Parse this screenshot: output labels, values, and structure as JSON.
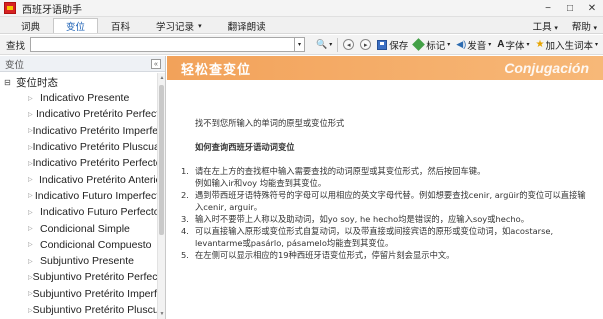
{
  "window": {
    "title": "西班牙语助手",
    "controls": {
      "minimize": "−",
      "maximize": "□",
      "close": "✕"
    }
  },
  "menu": {
    "tabs": [
      {
        "label": "词典",
        "active": false
      },
      {
        "label": "变位",
        "active": true
      },
      {
        "label": "百科",
        "active": false
      },
      {
        "label": "学习记录",
        "active": false,
        "dropdown": true
      },
      {
        "label": "翻译朗读",
        "active": false
      }
    ],
    "right": [
      {
        "label": "工具",
        "dropdown": true
      },
      {
        "label": "帮助",
        "dropdown": true
      }
    ],
    "dropdown_arrow": "▾"
  },
  "toolbar": {
    "search_label": "查找",
    "search_value": "",
    "search_dropdown": "▾",
    "search_icon": "magnifier-icon",
    "back": "◂",
    "forward": "▸",
    "save_label": "保存",
    "tag_label": "标记",
    "pronounce_label": "发音",
    "font_label": "字体",
    "add_vocab_label": "加入生词本",
    "speaker_glyph": "◀)",
    "font_glyph": "A",
    "star_glyph": "★",
    "dropdown_arrow": "▾",
    "magnifier_glyph": "🔍"
  },
  "sidebar": {
    "header": "变位",
    "collapse": "«",
    "root": {
      "label": "变位时态",
      "toggle": "⊟"
    },
    "items": [
      "Indicativo Presente",
      "Indicativo Pretérito Perfecto",
      "Indicativo Pretérito Imperfecto",
      "Indicativo Pretérito Pluscuamperfecto",
      "Indicativo Pretérito Perfecto Simple",
      "Indicativo Pretérito Anterior",
      "Indicativo Futuro Imperfecto",
      "Indicativo Futuro Perfecto",
      "Condicional Simple",
      "Condicional Compuesto",
      "Subjuntivo Presente",
      "Subjuntivo Pretérito Perfecto",
      "Subjuntivo Pretérito Imperfecto",
      "Subjuntivo Pretérito Pluscuamperfecto"
    ],
    "item_marker": "▷"
  },
  "content": {
    "banner_left": "轻松查变位",
    "banner_right": "Conjugación",
    "message": "找不到您所输入的单词的原型或变位形式",
    "subhead": "如何查询西班牙语动词变位",
    "steps": [
      {
        "num": "1.",
        "lines": [
          "请在左上方的查找框中输入需要查找的动词原型或其变位形式，然后按回车键。",
          "例如输入ir和voy 均能查到其变位。"
        ]
      },
      {
        "num": "2.",
        "lines": [
          "遇到带西班牙语特殊符号的字母可以用相应的英文字母代替。例如想要查找cenir, argüir的变位可以直接输",
          "入cenir, arguir。"
        ]
      },
      {
        "num": "3.",
        "lines": [
          "输入时不要带上人称以及助动词，如yo soy, he hecho均是错误的，应输入soy或hecho。"
        ]
      },
      {
        "num": "4.",
        "lines": [
          "可以直接输入原形或变位形式自复动词，以及带直接或间接宾语的原形或变位动词，如acostarse,",
          "levantarme或pasárlo, pásamelo均能查到其变位。"
        ]
      },
      {
        "num": "5.",
        "lines": [
          "在左侧可以显示相应的19种西班牙语变位形式，停留片刻会显示中文。"
        ]
      }
    ]
  },
  "colors": {
    "banner": "#f2a25a",
    "active_tab_text": "#1a5fb4",
    "app_icon_red": "#d62222",
    "app_icon_yellow": "#f5c400"
  }
}
